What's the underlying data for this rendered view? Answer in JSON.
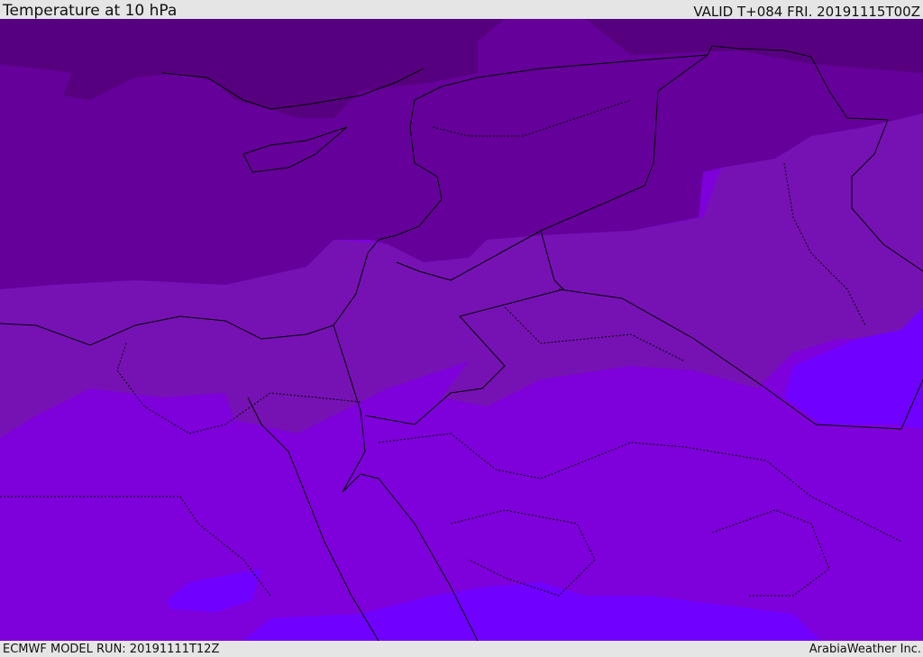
{
  "header": {
    "title": "Temperature at 10 hPa",
    "valid": "VALID T+084 FRI. 20191115T00Z"
  },
  "footer": {
    "model_run": "ECMWF MODEL RUN: 20191111T12Z",
    "credit": "ArabiaWeather Inc."
  },
  "palette": [
    "#57007f",
    "#65009a",
    "#7612b4",
    "#7e00da",
    "#7000ff"
  ]
}
